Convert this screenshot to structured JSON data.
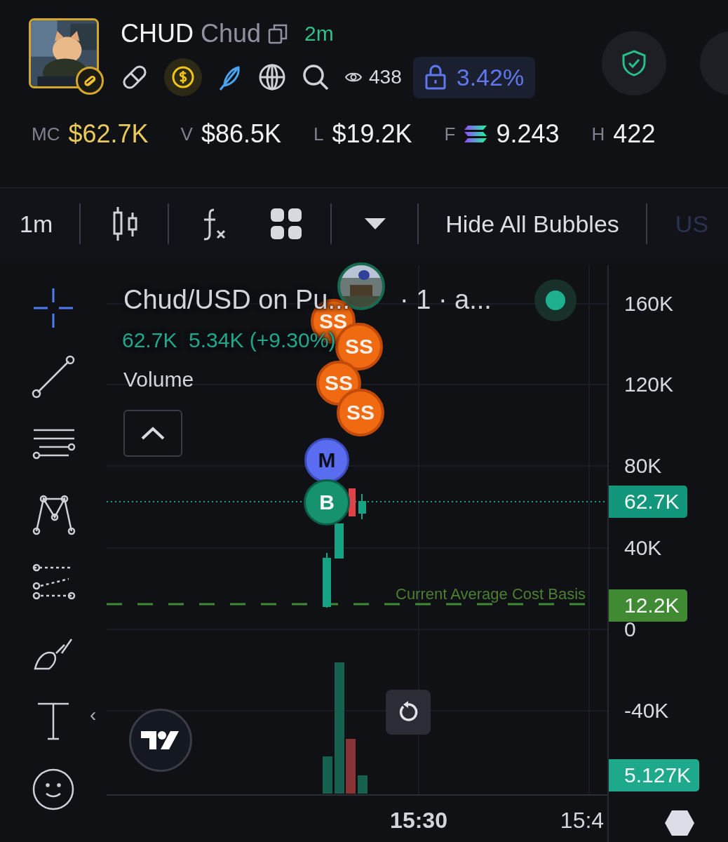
{
  "token": {
    "symbol": "CHUD",
    "name": "Chud",
    "age": "2m",
    "views": "438",
    "locked": "3.42%"
  },
  "stats": [
    {
      "label": "MC",
      "value": "$62.7K",
      "accent": true,
      "kind": "plain"
    },
    {
      "label": "V",
      "value": "$86.5K",
      "accent": false,
      "kind": "plain"
    },
    {
      "label": "L",
      "value": "$19.2K",
      "accent": false,
      "kind": "plain"
    },
    {
      "label": "F",
      "value": "9.243",
      "accent": false,
      "kind": "sol"
    },
    {
      "label": "H",
      "value": "422",
      "accent": false,
      "kind": "plain"
    }
  ],
  "toolbar": {
    "interval": "1m",
    "bubbles_button": "Hide All Bubbles",
    "cut_label": "US"
  },
  "drawing_tools": [
    {
      "kind": "crosshair",
      "selected": true
    },
    {
      "kind": "trend-line",
      "selected": false
    },
    {
      "kind": "lines",
      "selected": false
    },
    {
      "kind": "pattern",
      "selected": false
    },
    {
      "kind": "projection",
      "selected": false
    },
    {
      "kind": "brush",
      "selected": false
    },
    {
      "kind": "text",
      "selected": false
    },
    {
      "kind": "emoji",
      "selected": false
    }
  ],
  "collapse_arrow": "‹",
  "chart": {
    "legend": {
      "title": "Chud/USD on Pu...",
      "interval": "· 1 · a...",
      "price": "62.7K",
      "change": "5.34K (+9.30%)",
      "volume_label": "Volume"
    },
    "y_labels": [
      "160K",
      "120K",
      "80K",
      "40K",
      "0",
      "-40K"
    ],
    "x_labels": [
      {
        "text": "15:30",
        "bold": true
      },
      {
        "text": "15:4",
        "bold": false
      }
    ],
    "price_tags": [
      {
        "text": "62.7K",
        "kind": "last"
      },
      {
        "text": "12.2K",
        "kind": "cost"
      },
      {
        "text": "5.127K",
        "kind": "volume"
      }
    ],
    "cost_basis_label": "Current Average Cost Basis",
    "bubbles": [
      {
        "kind": "avatar"
      },
      {
        "kind": "sell",
        "label": "SS"
      },
      {
        "kind": "sell",
        "label": "SS"
      },
      {
        "kind": "sell",
        "label": "SS"
      },
      {
        "kind": "sell",
        "label": "SS"
      },
      {
        "kind": "mint",
        "label": "M"
      },
      {
        "kind": "buy",
        "label": "B"
      }
    ]
  }
}
